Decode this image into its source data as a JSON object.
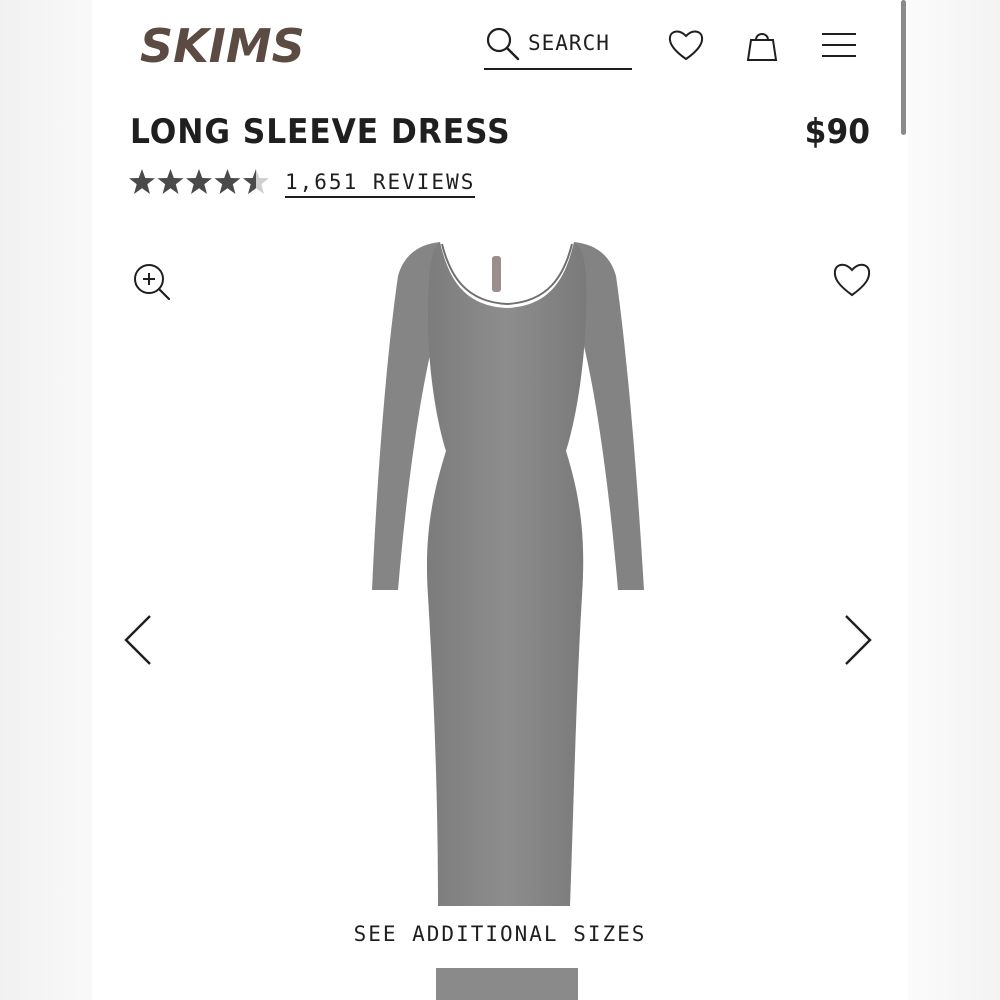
{
  "brand": {
    "name": "SKIMS",
    "color": "#5c4b43"
  },
  "header": {
    "search_label": "SEARCH",
    "icons": [
      "search-icon",
      "heart-icon",
      "shopping-bag-icon",
      "hamburger-menu-icon"
    ]
  },
  "product": {
    "title": "LONG SLEEVE DRESS",
    "price": "$90",
    "rating": 4.5,
    "rating_max": 5,
    "reviews_label": "1,651 REVIEWS",
    "image_alt_color": "#8a8a8a"
  },
  "gallery": {
    "icons": [
      "zoom-in-icon",
      "heart-icon",
      "chevron-left-icon",
      "chevron-right-icon"
    ],
    "see_sizes_label": "SEE ADDITIONAL SIZES"
  },
  "colors": {
    "star": "#4a4a4a",
    "text": "#1f1f1f",
    "background": "#ffffff"
  }
}
